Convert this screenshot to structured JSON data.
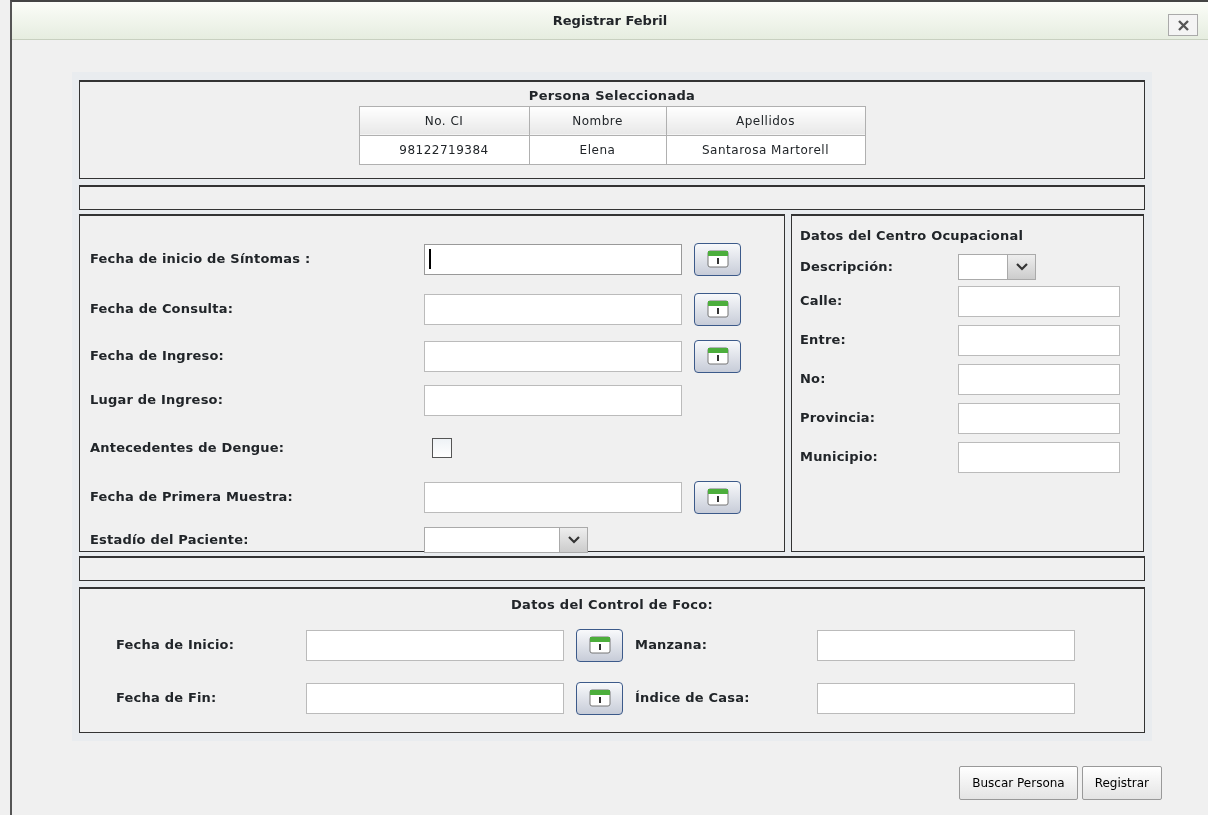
{
  "window": {
    "title": "Registrar Febril"
  },
  "selected_person": {
    "title": "Persona Seleccionada",
    "columns": [
      "No. CI",
      "Nombre",
      "Apellidos"
    ],
    "rows": [
      [
        "98122719384",
        "Elena",
        "Santarosa Martorell"
      ]
    ]
  },
  "symptoms_form": {
    "fields": [
      {
        "label": "Fecha de inicio de Síntomas :",
        "kind": "date",
        "focused": true
      },
      {
        "label": "Fecha de Consulta:",
        "kind": "date",
        "focused": false
      },
      {
        "label": "Fecha de Ingreso:",
        "kind": "date",
        "focused": false
      },
      {
        "label": "Lugar de Ingreso:",
        "kind": "text",
        "focused": false
      },
      {
        "label": "Antecedentes de Dengue:",
        "kind": "checkbox",
        "checked": false
      },
      {
        "label": "Fecha de Primera Muestra:",
        "kind": "date",
        "focused": false
      },
      {
        "label": "Estadío del Paciente:",
        "kind": "select"
      }
    ]
  },
  "occupational_center": {
    "title": "Datos del Centro Ocupacional",
    "fields": [
      {
        "label": "Descripción:",
        "kind": "select"
      },
      {
        "label": "Calle:",
        "kind": "text"
      },
      {
        "label": "Entre:",
        "kind": "text"
      },
      {
        "label": "No:",
        "kind": "text"
      },
      {
        "label": "Provincia:",
        "kind": "text"
      },
      {
        "label": "Municipio:",
        "kind": "text"
      }
    ]
  },
  "focus_control": {
    "title": "Datos del Control de Foco:",
    "fields": [
      {
        "label": "Fecha de Inicio:",
        "kind": "date"
      },
      {
        "label": "Manzana:",
        "kind": "text"
      },
      {
        "label": "Fecha de Fin:",
        "kind": "date"
      },
      {
        "label": "Índice de Casa:",
        "kind": "text"
      }
    ]
  },
  "buttons": [
    "Buscar Persona",
    "Registrar"
  ]
}
